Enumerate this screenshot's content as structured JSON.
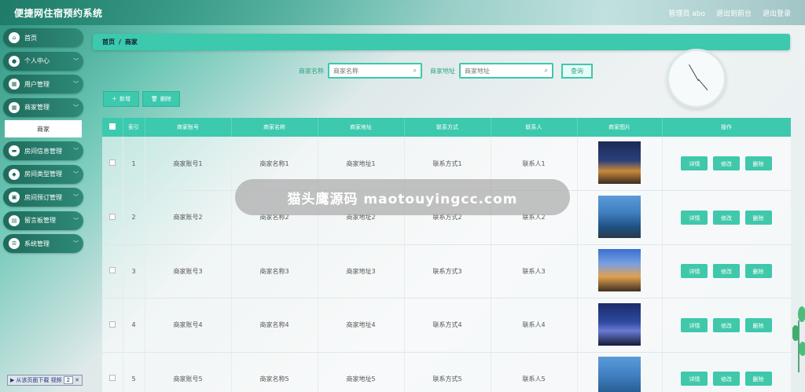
{
  "header": {
    "app_title": "便捷网住宿预约系统",
    "user_label": "管理员 abo",
    "back_to_front": "退出到前台",
    "logout": "退出登录"
  },
  "sidebar": {
    "items": [
      {
        "label": "首页",
        "icon": "home-icon",
        "has_children": false
      },
      {
        "label": "个人中心",
        "icon": "user-icon",
        "has_children": true
      },
      {
        "label": "用户管理",
        "icon": "grid-icon",
        "has_children": true
      },
      {
        "label": "商家管理",
        "icon": "grid-icon",
        "has_children": true
      },
      {
        "label": "房间信息管理",
        "icon": "bed-icon",
        "has_children": true
      },
      {
        "label": "房间类型管理",
        "icon": "tag-icon",
        "has_children": true
      },
      {
        "label": "房间预订管理",
        "icon": "briefcase-icon",
        "has_children": true
      },
      {
        "label": "留言板管理",
        "icon": "message-icon",
        "has_children": true
      },
      {
        "label": "系统管理",
        "icon": "settings-icon",
        "has_children": true
      }
    ],
    "active_sub_item": "商家"
  },
  "breadcrumb": {
    "home": "首页",
    "separator": "/",
    "current": "商家"
  },
  "search": {
    "name_label": "商家名称",
    "name_placeholder": "商家名称",
    "address_label": "商家地址",
    "address_placeholder": "商家地址",
    "query_button": "查询"
  },
  "actions": {
    "add_label": "新增",
    "delete_label": "删除"
  },
  "table": {
    "headers": [
      "索引",
      "商家账号",
      "商家名称",
      "商家地址",
      "联系方式",
      "联系人",
      "商家图片",
      "操作"
    ],
    "rows": [
      {
        "index": "1",
        "account": "商家账号1",
        "name": "商家名称1",
        "address": "商家地址1",
        "contact": "联系方式1",
        "person": "联系人1"
      },
      {
        "index": "2",
        "account": "商家账号2",
        "name": "商家名称2",
        "address": "商家地址2",
        "contact": "联系方式2",
        "person": "联系人2"
      },
      {
        "index": "3",
        "account": "商家账号3",
        "name": "商家名称3",
        "address": "商家地址3",
        "contact": "联系方式3",
        "person": "联系人3"
      },
      {
        "index": "4",
        "account": "商家账号4",
        "name": "商家名称4",
        "address": "商家地址4",
        "contact": "联系方式4",
        "person": "联系人4"
      },
      {
        "index": "5",
        "account": "商家账号5",
        "name": "商家名称5",
        "address": "商家地址5",
        "contact": "联系方式5",
        "person": "联系人5"
      }
    ],
    "op_detail": "详情",
    "op_edit": "修改",
    "op_delete": "删除"
  },
  "watermark": {
    "text": "猫头鹰源码 maotouyingcc.com"
  },
  "download_bar": {
    "label": "从该页面下载 视频",
    "page": "2"
  },
  "colors": {
    "accent": "#3cc9ad",
    "sidebar": "#1f6b5c"
  }
}
